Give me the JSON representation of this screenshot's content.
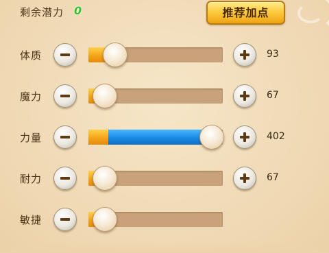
{
  "header": {
    "remaining_label": "剩余潜力",
    "remaining_value": "0",
    "recommend_button": "推荐加点"
  },
  "attributes": [
    {
      "label": "体质",
      "value": "93",
      "fill_fraction": 0.2,
      "blue_fraction": 0.0,
      "has_plus": true
    },
    {
      "label": "魔力",
      "value": "67",
      "fill_fraction": 0.12,
      "blue_fraction": 0.0,
      "has_plus": true
    },
    {
      "label": "力量",
      "value": "402",
      "fill_fraction": 0.15,
      "blue_fraction": 0.92,
      "has_plus": true
    },
    {
      "label": "耐力",
      "value": "67",
      "fill_fraction": 0.12,
      "blue_fraction": 0.0,
      "has_plus": true
    },
    {
      "label": "敏捷",
      "value": "",
      "fill_fraction": 0.12,
      "blue_fraction": 0.0,
      "has_plus": false
    }
  ],
  "colors": {
    "accent_orange": "#f4a41a",
    "accent_blue": "#1a8ae6",
    "remaining_green": "#33c12c",
    "button_gold": "#fbc93a"
  },
  "icons": {
    "minus": "minus-icon",
    "plus": "plus-icon"
  }
}
